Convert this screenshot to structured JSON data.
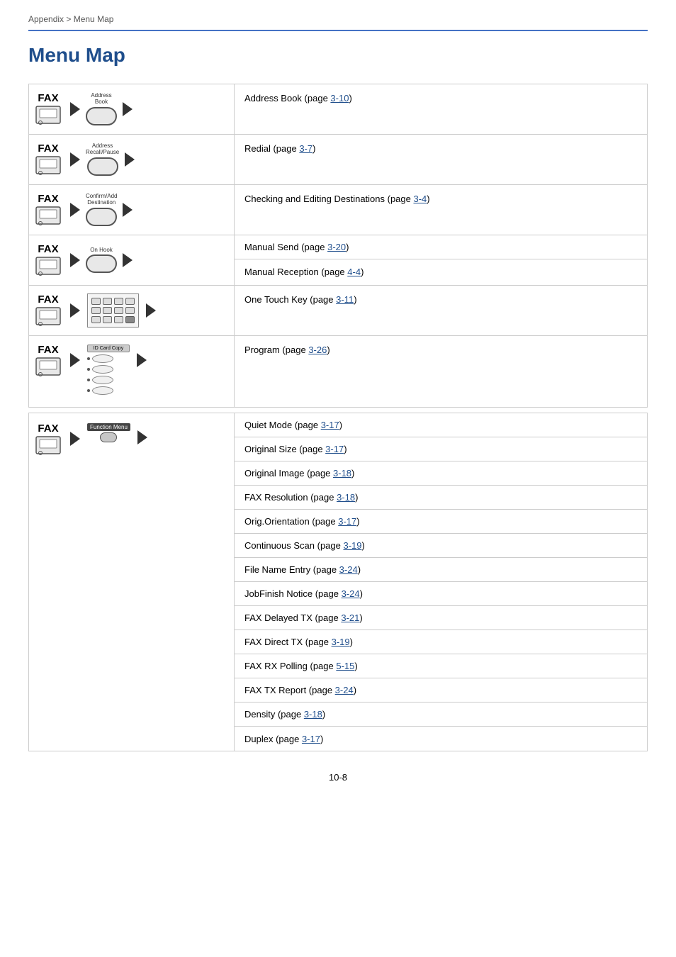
{
  "breadcrumb": "Appendix > Menu Map",
  "title": "Menu Map",
  "accentColor": "#1f4e8c",
  "sections": [
    {
      "id": "address-book",
      "leftLabel1": "FAX",
      "leftLabel2": "Address Book",
      "rightCells": [
        {
          "text": "Address Book (page ",
          "link": "3-10",
          "after": ")"
        }
      ]
    },
    {
      "id": "address-recall",
      "leftLabel1": "FAX",
      "leftLabel2": "Address Recall/Pause",
      "rightCells": [
        {
          "text": "Redial (page ",
          "link": "3-7",
          "after": ")"
        }
      ]
    },
    {
      "id": "confirm-add",
      "leftLabel1": "FAX",
      "leftLabel2": "Confirm/Add Destination",
      "rightCells": [
        {
          "text": "Checking and Editing Destinations (page ",
          "link": "3-4",
          "after": ")"
        }
      ]
    },
    {
      "id": "on-hook",
      "leftLabel1": "FAX",
      "leftLabel2": "On Hook",
      "rightCells": [
        {
          "text": "Manual Send (page ",
          "link": "3-20",
          "after": ")"
        },
        {
          "text": "Manual Reception (page ",
          "link": "4-4",
          "after": ")"
        }
      ]
    },
    {
      "id": "one-touch",
      "leftLabel1": "FAX",
      "leftLabel2": "OneTouch",
      "rightCells": [
        {
          "text": "One Touch Key (page ",
          "link": "3-11",
          "after": ")"
        }
      ]
    },
    {
      "id": "program",
      "leftLabel1": "FAX",
      "leftLabel2": "Program",
      "rightCells": [
        {
          "text": "Program (page ",
          "link": "3-26",
          "after": ")"
        }
      ]
    },
    {
      "id": "function-menu",
      "leftLabel1": "FAX",
      "leftLabel2": "Function Menu",
      "rightCells": [
        {
          "text": "Quiet Mode (page ",
          "link": "3-17",
          "after": ")"
        },
        {
          "text": "Original Size (page ",
          "link": "3-17",
          "after": ")"
        },
        {
          "text": "Original Image (page ",
          "link": "3-18",
          "after": ")"
        },
        {
          "text": "FAX Resolution (page ",
          "link": "3-18",
          "after": ")"
        },
        {
          "text": "Orig.Orientation (page ",
          "link": "3-17",
          "after": ")"
        },
        {
          "text": "Continuous Scan (page ",
          "link": "3-19",
          "after": ")"
        },
        {
          "text": "File Name Entry (page ",
          "link": "3-24",
          "after": ")"
        },
        {
          "text": "JobFinish Notice (page ",
          "link": "3-24",
          "after": ")"
        },
        {
          "text": "FAX Delayed TX (page ",
          "link": "3-21",
          "after": ")"
        },
        {
          "text": "FAX Direct TX (page ",
          "link": "3-19",
          "after": ")"
        },
        {
          "text": "FAX RX Polling (page ",
          "link": "5-15",
          "after": ")"
        },
        {
          "text": "FAX TX Report (page ",
          "link": "3-24",
          "after": ")"
        },
        {
          "text": "Density (page ",
          "link": "3-18",
          "after": ")"
        },
        {
          "text": "Duplex (page ",
          "link": "3-17",
          "after": ")"
        }
      ]
    }
  ],
  "pageNumber": "10-8"
}
